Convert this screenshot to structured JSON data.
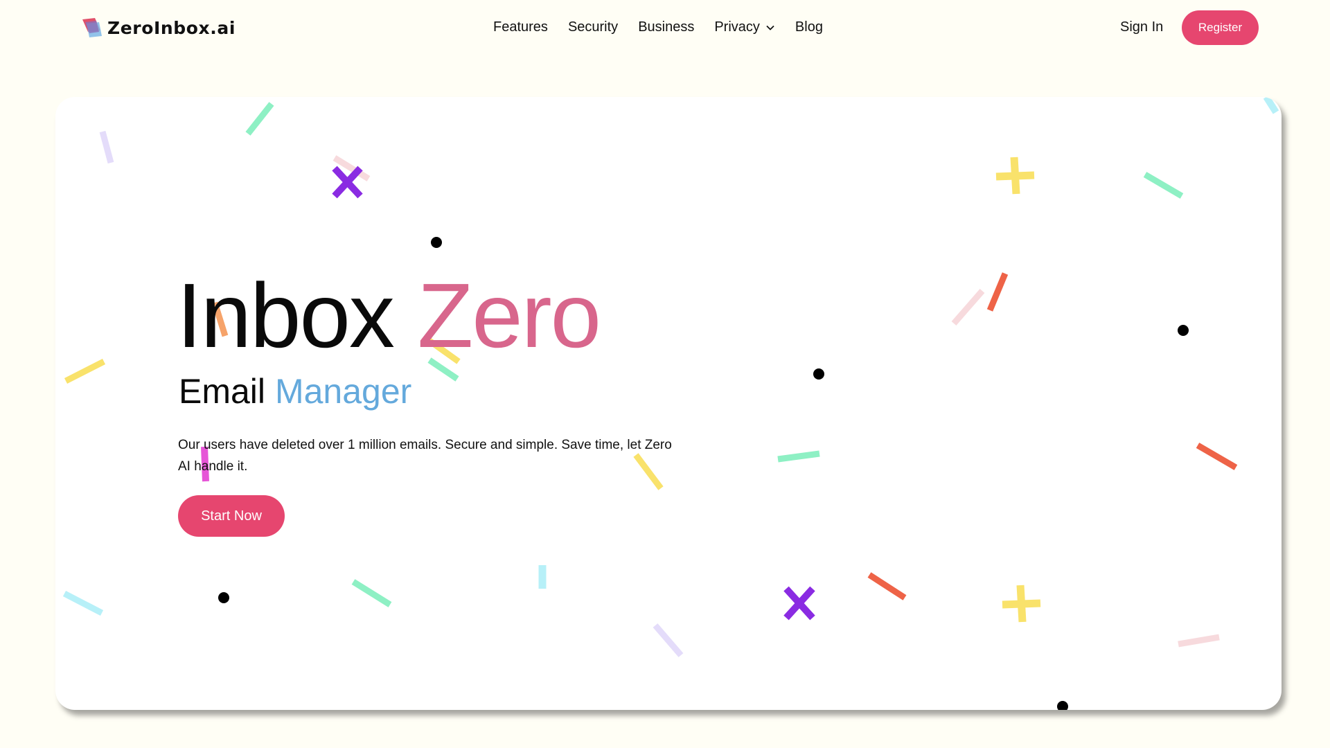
{
  "brand": {
    "name": "ZeroInbox.ai",
    "logo_icon": "zeroinbox-logo"
  },
  "nav": {
    "links": [
      {
        "label": "Features"
      },
      {
        "label": "Security"
      },
      {
        "label": "Business"
      },
      {
        "label": "Privacy",
        "has_dropdown": true
      },
      {
        "label": "Blog"
      }
    ],
    "sign_in": "Sign In",
    "register": "Register"
  },
  "hero": {
    "title_word1": "Inbox",
    "title_word2": "Zero",
    "subtitle_word1": "Email",
    "subtitle_word2": "Manager",
    "description": "Our users have deleted over 1 million emails. Secure and simple. Save time, let Zero AI handle it.",
    "cta": "Start Now"
  },
  "colors": {
    "page_background": "#fffef5",
    "accent_pink": "#e6466f",
    "title_accent": "#d8668c",
    "subtitle_accent": "#64a9dc",
    "confetti": [
      "#8ef0c4",
      "#e4dcfa",
      "#8a2be2",
      "#f7dadd",
      "#f9e26b",
      "#ee6347",
      "#b7f0f8",
      "#f6a36a",
      "#e655d7",
      "#000000"
    ]
  }
}
